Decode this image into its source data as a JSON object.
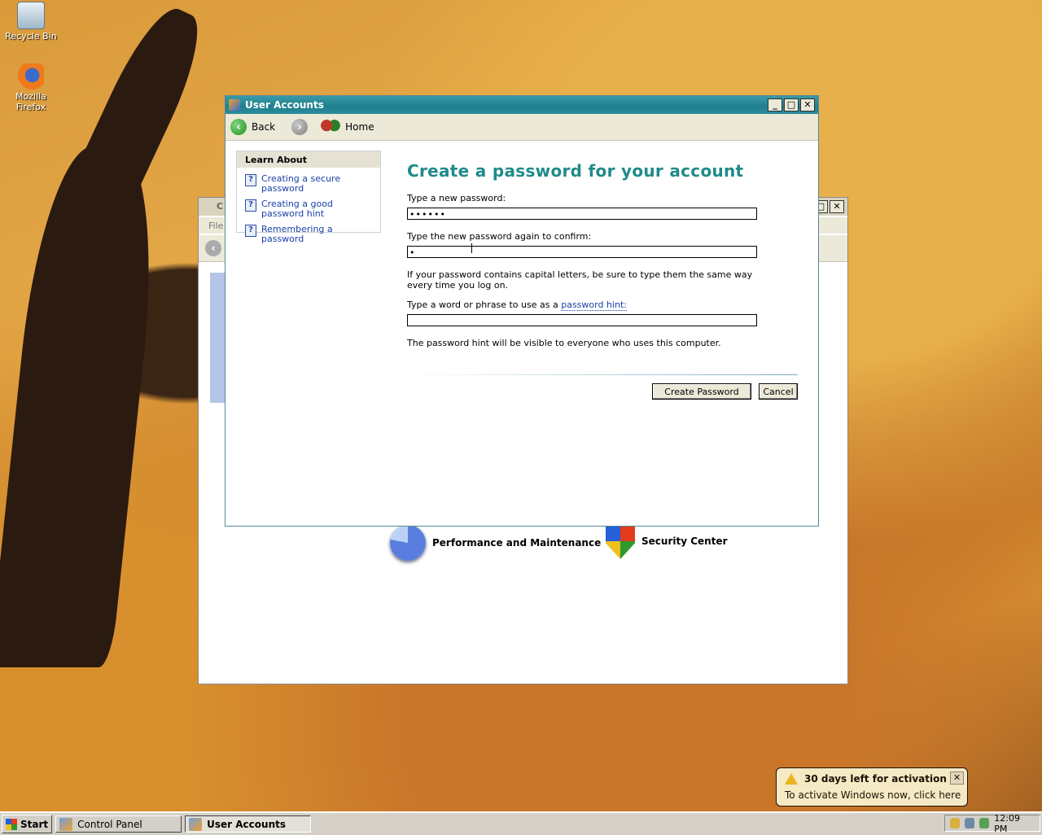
{
  "desktop": {
    "icons": [
      {
        "label": "Recycle Bin",
        "icon": "recycle-bin-icon"
      },
      {
        "label": "Mozilla Firefox",
        "icon": "firefox-icon"
      }
    ]
  },
  "background_window": {
    "title_initial": "C",
    "menu_first": "File",
    "categories": [
      {
        "label": "Performance and Maintenance",
        "icon": "performance-maintenance-icon"
      },
      {
        "label": "Security Center",
        "icon": "security-center-shield-icon"
      }
    ]
  },
  "ua_window": {
    "title": "User Accounts",
    "controls": {
      "minimize": "_",
      "maximize": "□",
      "close": "✕"
    },
    "toolbar": {
      "back": "Back",
      "home": "Home"
    },
    "learn_about": {
      "header": "Learn About",
      "items": [
        "Creating a secure password",
        "Creating a good password hint",
        "Remembering a password"
      ]
    },
    "heading": "Create a password for your account",
    "new_password_label": "Type a new password:",
    "new_password_value": "••••••",
    "confirm_label": "Type the new password again to confirm:",
    "confirm_value": "•",
    "caps_note": "If your password contains capital letters, be sure to type them the same way every time you log on.",
    "hint_label_prefix": "Type a word or phrase to use as a",
    "hint_link": "password hint:",
    "hint_value": "",
    "hint_note": "The password hint will be visible to everyone who uses this computer.",
    "create_button": "Create Password",
    "cancel_button": "Cancel"
  },
  "taskbar": {
    "start": "Start",
    "tasks": [
      {
        "label": "Control Panel",
        "active": false
      },
      {
        "label": "User Accounts",
        "active": true
      }
    ],
    "clock": "12:09 PM"
  },
  "balloon": {
    "title": "30 days left for activation",
    "body": "To activate Windows now, click here",
    "close": "✕"
  },
  "colors": {
    "title_teal": "#1f7f8e",
    "heading_teal": "#208a8a",
    "link_blue": "#1a3fa8"
  }
}
